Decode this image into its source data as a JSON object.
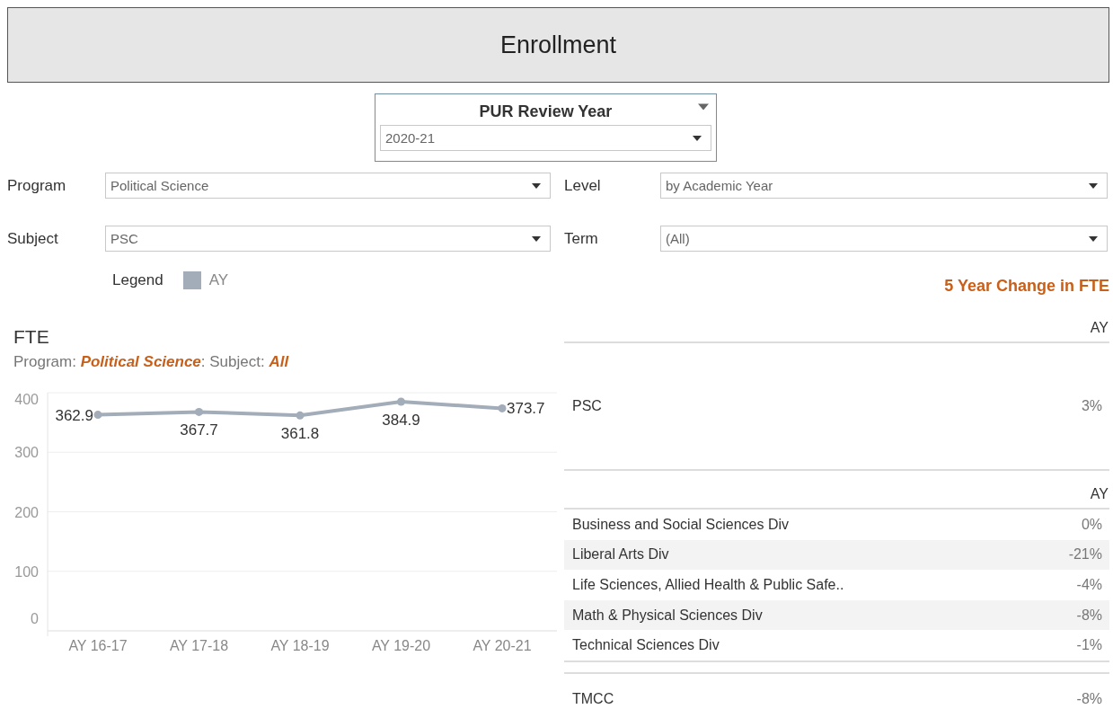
{
  "header": {
    "title": "Enrollment"
  },
  "review_year": {
    "label": "PUR Review Year",
    "value": "2020-21"
  },
  "filters": [
    {
      "label": "Program",
      "value": "Political Science"
    },
    {
      "label": "Level",
      "value": "by Academic Year"
    },
    {
      "label": "Subject",
      "value": "PSC"
    },
    {
      "label": "Term",
      "value": "(All)"
    }
  ],
  "legend": {
    "label": "Legend"
  },
  "chart": {
    "title": "FTE",
    "subtitle": [
      {
        "text": "Program: ",
        "kind": "plain"
      },
      {
        "text": "Political Science",
        "kind": "value"
      },
      {
        "text": ": Subject: ",
        "kind": "plain"
      },
      {
        "text": "All",
        "kind": "value"
      }
    ],
    "chart_data": {
      "type": "line",
      "categories": [
        "AY 16-17",
        "AY 17-18",
        "AY 18-19",
        "AY 19-20",
        "AY 20-21"
      ],
      "series": [
        {
          "name": "AY",
          "color": "#a3acb9",
          "marker": true,
          "values": [
            362.9,
            367.7,
            361.8,
            384.9,
            373.7
          ]
        }
      ],
      "ylim": [
        0,
        400
      ],
      "yticks": [
        0,
        100,
        200,
        300,
        400
      ],
      "grid": true,
      "marker": true,
      "data_labels": true
    }
  },
  "change_table": {
    "title": "5 Year Change in FTE",
    "sections": [
      {
        "column": "AY",
        "rows": [
          {
            "label": "PSC",
            "value": "3%"
          }
        ]
      },
      {
        "column": "AY",
        "rows": [
          {
            "label": "Business and Social Sciences Div",
            "value": "0%"
          },
          {
            "label": "Liberal Arts Div",
            "value": "-21%"
          },
          {
            "label": "Life Sciences, Allied Health & Public Safe..",
            "value": "-4%"
          },
          {
            "label": "Math & Physical Sciences Div",
            "value": "-8%"
          },
          {
            "label": "Technical Sciences Div",
            "value": "-1%"
          }
        ]
      },
      {
        "rows": [
          {
            "label": "TMCC",
            "value": "-8%"
          }
        ]
      }
    ]
  }
}
